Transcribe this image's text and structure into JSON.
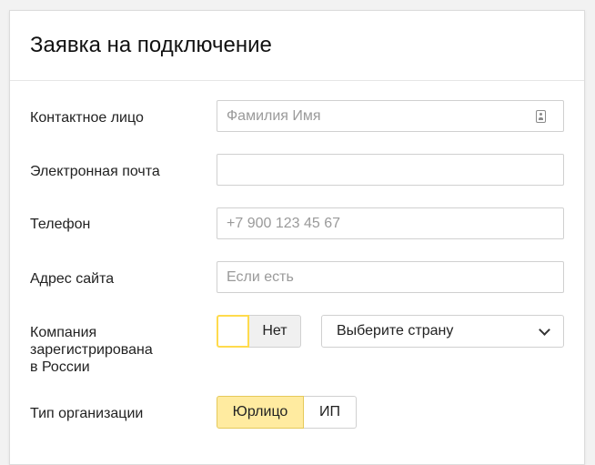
{
  "form": {
    "title": "Заявка на подключение",
    "fields": {
      "contact": {
        "label": "Контактное лицо",
        "placeholder": "Фамилия Имя",
        "value": ""
      },
      "email": {
        "label": "Электронная почта",
        "placeholder": "",
        "value": ""
      },
      "phone": {
        "label": "Телефон",
        "placeholder": "+7 900 123 45 67",
        "value": ""
      },
      "site": {
        "label": "Адрес сайта",
        "placeholder": "Если есть",
        "value": ""
      }
    },
    "company": {
      "label_line1": "Компания",
      "label_line2": "зарегистрирована",
      "label_line3": "в России",
      "toggle_no": "Нет",
      "country_select": "Выберите страну"
    },
    "org_type": {
      "label": "Тип организации",
      "options": [
        "Юрлицо",
        "ИП"
      ],
      "selected": "Юрлицо"
    }
  },
  "colors": {
    "accent_yellow": "#ffdb4d",
    "selected_fill": "#ffeba0",
    "border": "#d0d0d0"
  },
  "icons": {
    "contact_field": "contact-card-icon",
    "select_arrow": "chevron-down-icon"
  }
}
